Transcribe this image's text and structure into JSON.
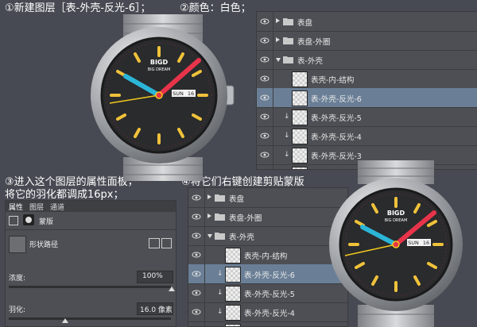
{
  "steps": {
    "step1": "①新建图层［表-外壳-反光-6］；",
    "step2": "②颜色：白色；",
    "step3_line1": "③进入这个图层的属性面板，",
    "step3_line2": "将它的羽化都调成16px；",
    "step4": "④将它们右键创建剪贴蒙版"
  },
  "watch": {
    "brand": "BIGD",
    "brand_sub": "BIG DREAM",
    "date_day": "SUN",
    "date_num": "16"
  },
  "layers_top": [
    {
      "label": "表盘",
      "kind": "folder"
    },
    {
      "label": "表盘-外圈",
      "kind": "folder"
    },
    {
      "label": "表-外壳",
      "kind": "folder-open"
    },
    {
      "label": "表壳-内-结构",
      "kind": "layer"
    },
    {
      "label": "表-外壳-反光-6",
      "kind": "layer-selected"
    },
    {
      "label": "表-外壳-反光-5",
      "kind": "clip"
    },
    {
      "label": "表-外壳-反光-4",
      "kind": "clip"
    },
    {
      "label": "表-外壳-反光-3",
      "kind": "clip"
    },
    {
      "label": "表-外壳-反光-2",
      "kind": "clip"
    }
  ],
  "layers_bottom": [
    {
      "label": "表盘",
      "kind": "folder"
    },
    {
      "label": "表盘-外圈",
      "kind": "folder"
    },
    {
      "label": "表-外壳",
      "kind": "folder-open"
    },
    {
      "label": "表壳-内-结构",
      "kind": "layer"
    },
    {
      "label": "表-外壳-反光-6",
      "kind": "clip-selected"
    },
    {
      "label": "表-外壳-反光-5",
      "kind": "clip"
    },
    {
      "label": "表-外壳-反光-4",
      "kind": "clip"
    },
    {
      "label": "表-外壳-反光-3",
      "kind": "clip"
    }
  ],
  "properties": {
    "tabs": [
      "属性",
      "图层",
      "通道"
    ],
    "mask_label": "蒙版",
    "path_label": "形状路径",
    "density_label": "浓度:",
    "density_value": "100%",
    "feather_label": "羽化:",
    "feather_value": "16.0 像素"
  },
  "colors": {
    "background": "#474a52",
    "selected_row": "#6a7f96",
    "hand_red": "#e8344a",
    "hand_cyan": "#2bb6d8",
    "second_hand": "#f2c81c",
    "marker": "#f0c23a"
  }
}
